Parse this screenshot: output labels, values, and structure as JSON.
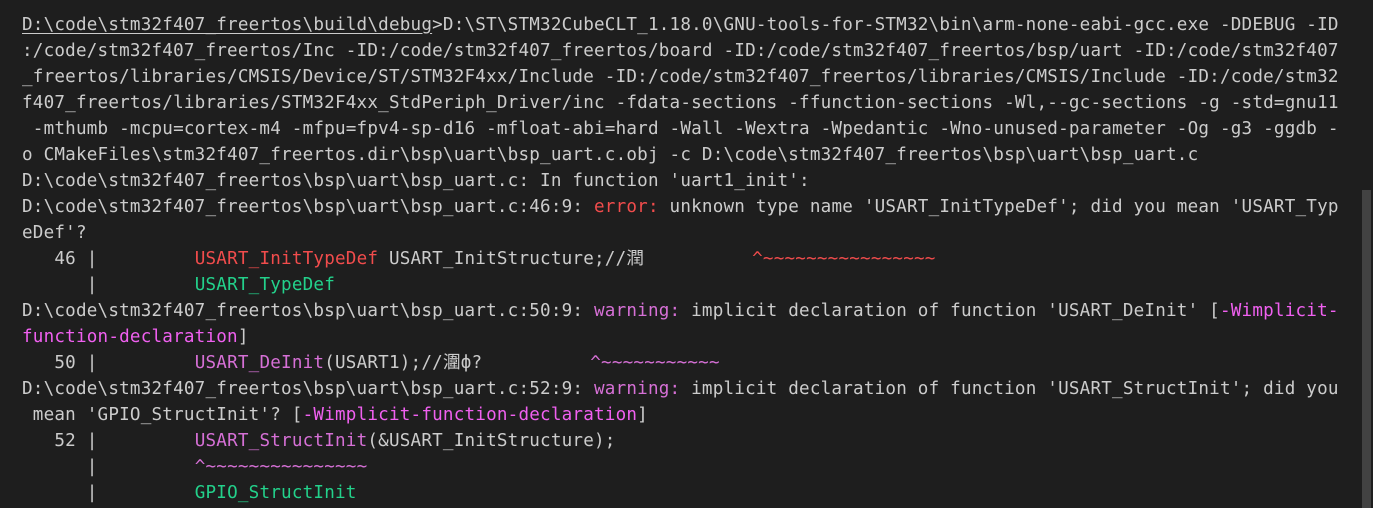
{
  "terminal": {
    "lines": {
      "l1": "D:\\code\\stm32f407_freertos\\build\\debug>D:\\ST\\STM32CubeCLT_1.18.0\\GNU-tools-for-STM32\\bin\\arm-none-eabi-gcc.exe -DDEBUG -ID",
      "l1_prompt": "D:\\code\\stm32f407_freertos\\build\\debug",
      "l1_rest": ">D:\\ST\\STM32CubeCLT_1.18.0\\GNU-tools-for-STM32\\bin\\arm-none-eabi-gcc.exe -DDEBUG -ID",
      "l2": ":/code/stm32f407_freertos/Inc -ID:/code/stm32f407_freertos/board -ID:/code/stm32f407_freertos/bsp/uart -ID:/code/stm32f407",
      "l3": "_freertos/libraries/CMSIS/Device/ST/STM32F4xx/Include -ID:/code/stm32f407_freertos/libraries/CMSIS/Include -ID:/code/stm32",
      "l4": "f407_freertos/libraries/STM32F4xx_StdPeriph_Driver/inc -fdata-sections -ffunction-sections -Wl,--gc-sections -g -std=gnu11",
      "l5": " -mthumb -mcpu=cortex-m4 -mfpu=fpv4-sp-d16 -mfloat-abi=hard -Wall -Wextra -Wpedantic -Wno-unused-parameter -Og -g3 -ggdb -",
      "l6": "o CMakeFiles\\stm32f407_freertos.dir\\bsp\\uart\\bsp_uart.c.obj -c D:\\code\\stm32f407_freertos\\bsp\\uart\\bsp_uart.c",
      "l7": "D:\\code\\stm32f407_freertos\\bsp\\uart\\bsp_uart.c: In function 'uart1_init':",
      "l8_loc": "D:\\code\\stm32f407_freertos\\bsp\\uart\\bsp_uart.c:46:9: ",
      "l8_kind": "error:",
      "l8_msg": " unknown type name 'USART_InitTypeDef'; did you mean 'USART_Typ",
      "l9": "eDef'?",
      "l10_gutter": "   46 |         ",
      "l10_hl": "USART_InitTypeDef",
      "l10_rest": " USART_InitStructure;//潤          ",
      "l10_caret": "^~~~~~~~~~~~~~~~~",
      "l11_gutter": "      |         ",
      "l11_fix": "USART_TypeDef",
      "l12_loc": "D:\\code\\stm32f407_freertos\\bsp\\uart\\bsp_uart.c:50:9: ",
      "l12_kind": "warning:",
      "l12_msg": " implicit declaration of function 'USART_DeInit' [",
      "l12_flag": "-Wimplicit-",
      "l13_flag": "function-declaration",
      "l13_end": "]",
      "l14_gutter": "   50 |         ",
      "l14_hl": "USART_DeInit",
      "l14_rest": "(USART1);//潿ф?          ",
      "l14_caret": "^~~~~~~~~~~~",
      "l15_loc": "D:\\code\\stm32f407_freertos\\bsp\\uart\\bsp_uart.c:52:9: ",
      "l15_kind": "warning:",
      "l15_msg": " implicit declaration of function 'USART_StructInit'; did you",
      "l16_a": " mean 'GPIO_StructInit'? [",
      "l16_flag": "-Wimplicit-function-declaration",
      "l16_end": "]",
      "l17_gutter": "   52 |         ",
      "l17_hl": "USART_StructInit",
      "l17_rest": "(&USART_InitStructure);",
      "l18_gutter": "      |         ",
      "l18_caret": "^~~~~~~~~~~~~~~~",
      "l19_gutter": "      |         ",
      "l19_fix": "GPIO_StructInit"
    }
  },
  "colors": {
    "background": "#1e1e1e",
    "text": "#cccccc",
    "error": "#f14c4c",
    "fixit": "#23d18b",
    "warning": "#d670d6",
    "flag": "#f060f0"
  }
}
